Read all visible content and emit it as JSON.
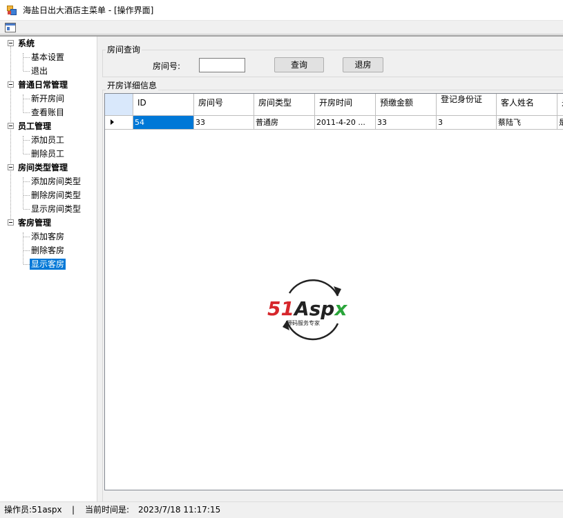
{
  "window": {
    "title": "海盐日出大酒店主菜单 - [操作界面]"
  },
  "tree": {
    "groups": [
      {
        "label": "系统",
        "items": [
          "基本设置",
          "退出"
        ]
      },
      {
        "label": "普通日常管理",
        "items": [
          "新开房间",
          "查看账目"
        ]
      },
      {
        "label": "员工管理",
        "items": [
          "添加员工",
          "删除员工"
        ]
      },
      {
        "label": "房间类型管理",
        "items": [
          "添加房间类型",
          "删除房间类型",
          "显示房间类型"
        ]
      },
      {
        "label": "客房管理",
        "items": [
          "添加客房",
          "删除客房",
          "显示客房"
        ]
      }
    ],
    "selected_item": "显示客房"
  },
  "query": {
    "group_title": "房间查询",
    "room_label": "房间号:",
    "room_value": "",
    "query_button": "查询",
    "checkout_button": "退房"
  },
  "details": {
    "group_title": "开房详细信息",
    "columns": [
      "ID",
      "房间号",
      "房间类型",
      "开房时间",
      "预缴金额",
      "登记身份证",
      "客人姓名",
      "是"
    ],
    "rows": [
      [
        "54",
        "33",
        "普通房",
        "2011-4-20 ...",
        "33",
        "3",
        "蔡陆飞",
        "是"
      ]
    ]
  },
  "logo": {
    "brand": "51Aspx",
    "tagline": "源码服务专家",
    "brand_red": "#d6262b",
    "brand_green": "#2aa53a"
  },
  "status": {
    "operator": "操作员:51aspx",
    "separator": "|",
    "time_label": "当前时间是:",
    "time_value": "2023/7/18  11:17:15"
  }
}
